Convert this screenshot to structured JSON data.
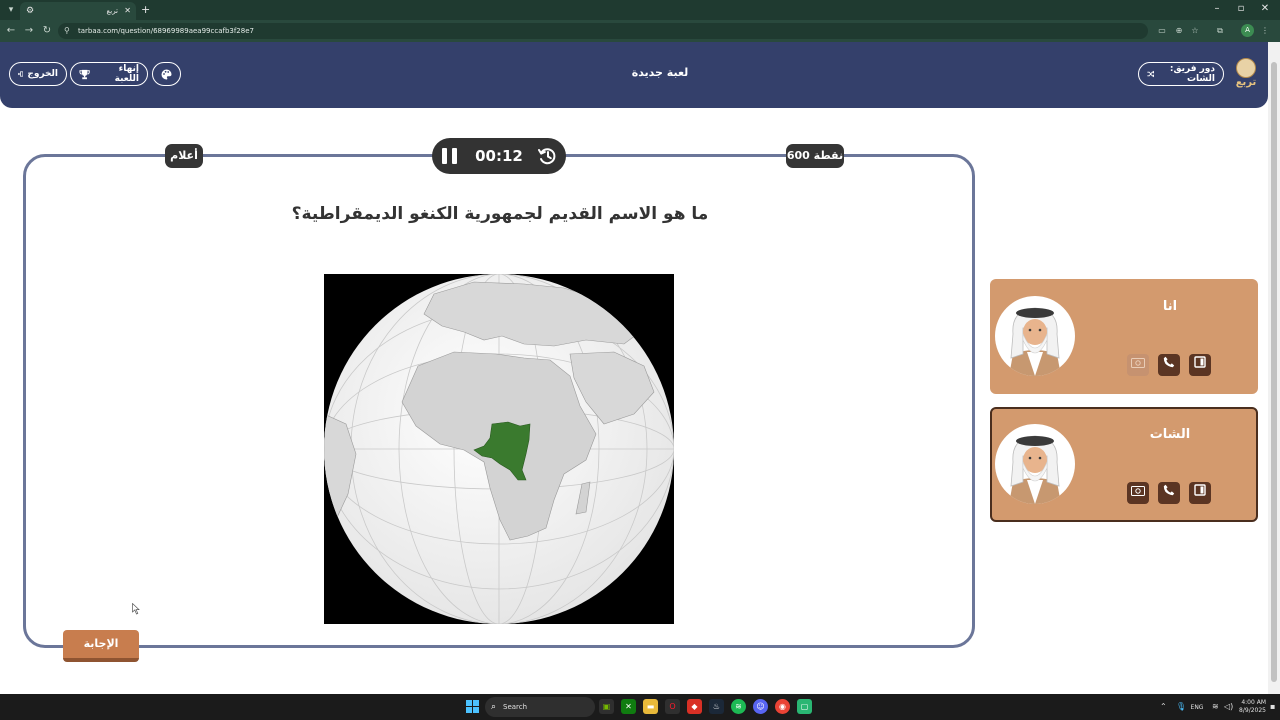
{
  "browser": {
    "tab_title": "تربع",
    "url": "tarbaa.com/question/68969989aea99ccafb3f28e7"
  },
  "header": {
    "exit_label": "الخروج",
    "end_game_label": "إنهاء اللعبة",
    "title": "لعبة جديدة",
    "turn_label": "دور فريق: الشات",
    "logo_text": "تربع"
  },
  "question": {
    "category": "أعلام",
    "points": "600 نقطة",
    "timer": "00:12",
    "text": "ما هو الاسم القديم لجمهورية الكنغو الديمقراطية؟",
    "answer_label": "الإجابة",
    "map_highlight_color": "#3a7a2e"
  },
  "teams": [
    {
      "name": "انا",
      "active": false
    },
    {
      "name": "الشات",
      "active": true
    }
  ],
  "taskbar": {
    "search_placeholder": "Search",
    "language": "ENG",
    "time": "4:00 AM",
    "date": "8/9/2025"
  },
  "colors": {
    "header_bg": "#34406b",
    "card_border": "#6b7699",
    "team_card_bg": "#d39a6e",
    "answer_button": "#c87d4e"
  }
}
